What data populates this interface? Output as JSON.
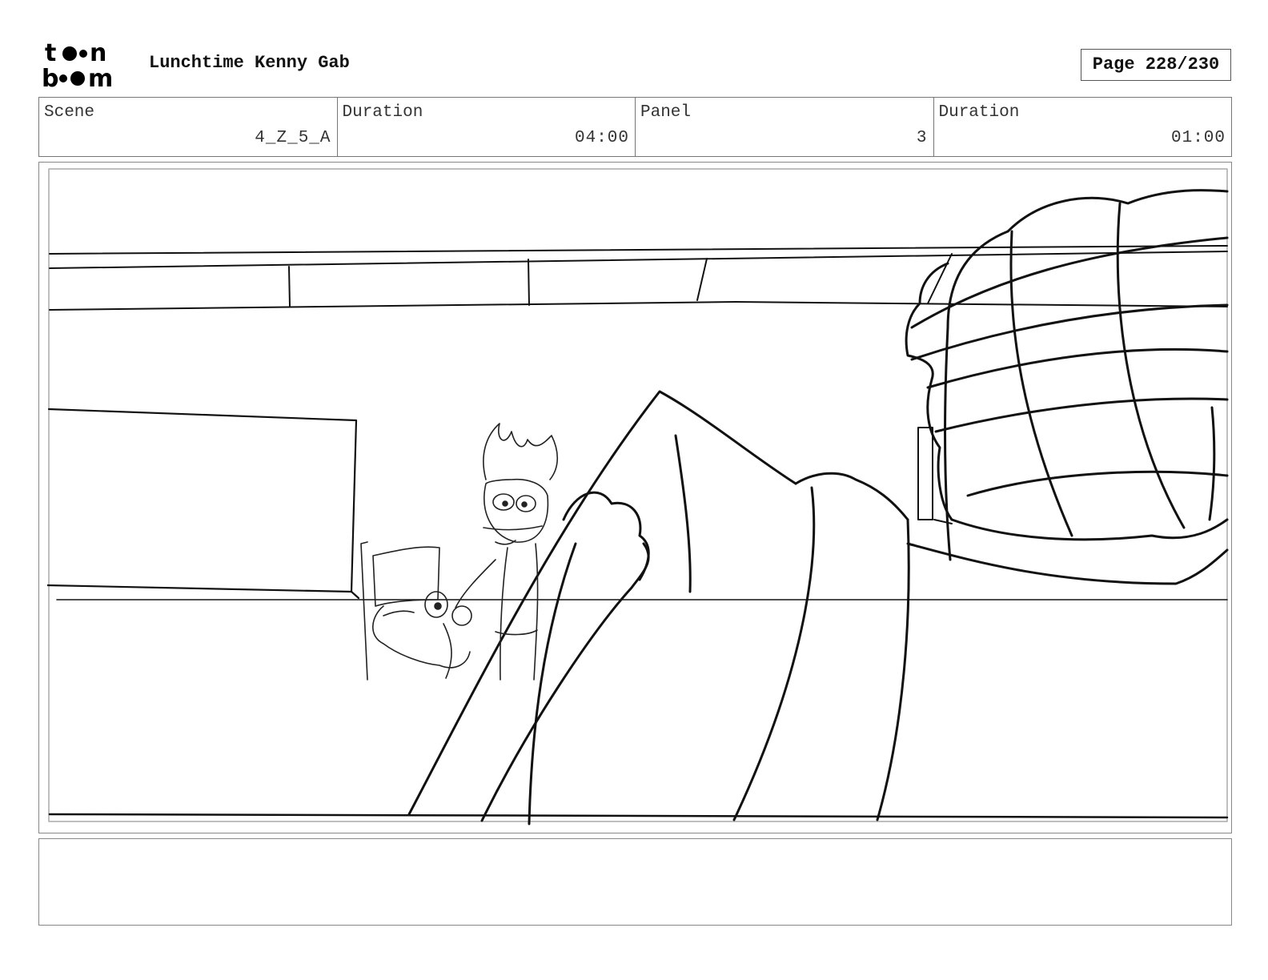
{
  "header": {
    "logo_top": "to•n",
    "logo_bottom": "b••m",
    "project_title": "Lunchtime Kenny Gab",
    "page_label": "Page 228/230"
  },
  "info": {
    "scene_label": "Scene",
    "scene_value": "4_Z_5_A",
    "scene_duration_label": "Duration",
    "scene_duration_value": "04:00",
    "panel_label": "Panel",
    "panel_value": "3",
    "panel_duration_label": "Duration",
    "panel_duration_value": "01:00"
  },
  "notes": {
    "text": ""
  }
}
